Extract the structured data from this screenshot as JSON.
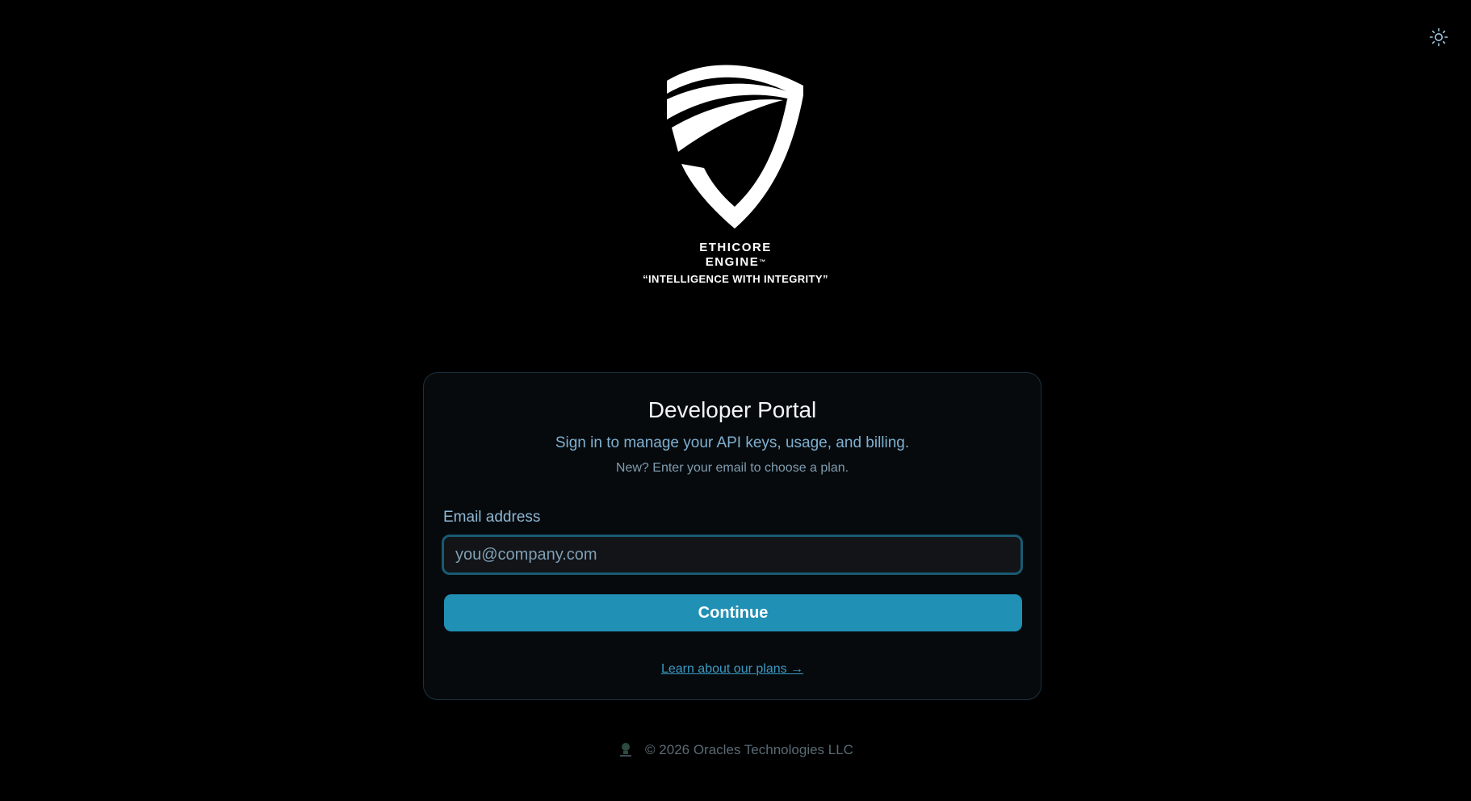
{
  "header": {
    "theme_toggle_icon": "sun-icon"
  },
  "brand": {
    "logo_icon": "shield-logo",
    "name_line1": "ETHICORE",
    "name_line2": "ENGINE",
    "trademark": "™",
    "tagline": "“INTELLIGENCE WITH INTEGRITY”"
  },
  "card": {
    "title": "Developer Portal",
    "subtitle": "Sign in to manage your API keys, usage, and billing.",
    "note": "New? Enter your email to choose a plan.",
    "email_label": "Email address",
    "email_placeholder": "you@company.com",
    "email_value": "",
    "continue_label": "Continue",
    "plans_link": "Learn about our plans →"
  },
  "footer": {
    "logo_icon": "oracles-logo",
    "copyright": "© 2026 Oracles Technologies LLC"
  },
  "colors": {
    "background": "#000000",
    "card_border": "#1b3140",
    "accent": "#2090b5",
    "link": "#3a9ac4",
    "subtitle": "#7fb0d0"
  }
}
